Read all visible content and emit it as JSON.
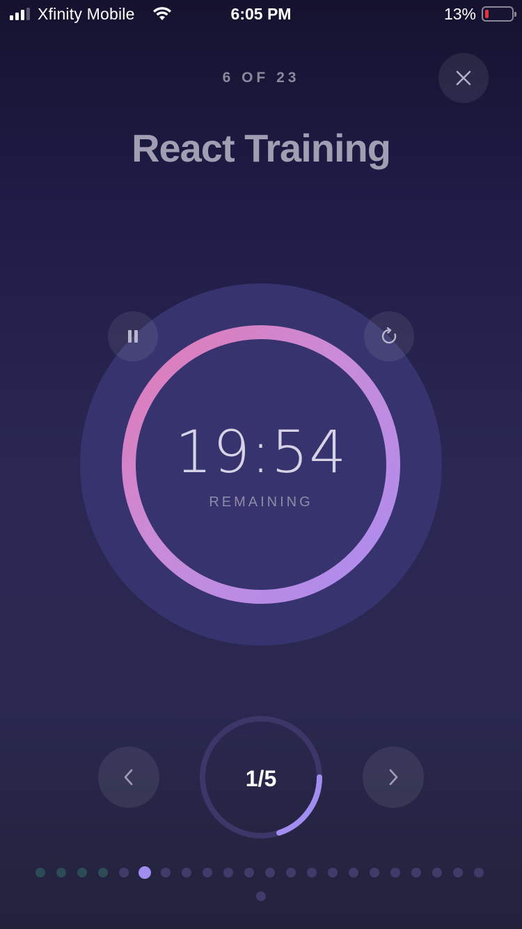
{
  "status_bar": {
    "carrier": "Xfinity Mobile",
    "time": "6:05 PM",
    "battery_percent": "13%",
    "battery_level": 0.13,
    "signal_bars": 3,
    "signal_bars_total": 4
  },
  "header": {
    "progress": "6 OF 23",
    "close_icon": "close-icon"
  },
  "title": "React Training",
  "timer": {
    "time": "19:54",
    "label": "REMAINING",
    "ring_progress": 1.0,
    "pause_icon": "pause-icon",
    "restart_icon": "restart-icon"
  },
  "step": {
    "label": "1/5",
    "current": 1,
    "total": 5,
    "prev_icon": "chevron-left-icon",
    "next_icon": "chevron-right-icon"
  },
  "pagination": {
    "total": 23,
    "current": 6,
    "completed": 4
  },
  "colors": {
    "ring_gradient_start": "#b08cee",
    "ring_gradient_end": "#e07db8",
    "step_arc": "#a28ef0",
    "dot_active": "#a28ef0",
    "dot_done": "#2d4a57",
    "dot_upcoming": "#3f3c6a"
  }
}
